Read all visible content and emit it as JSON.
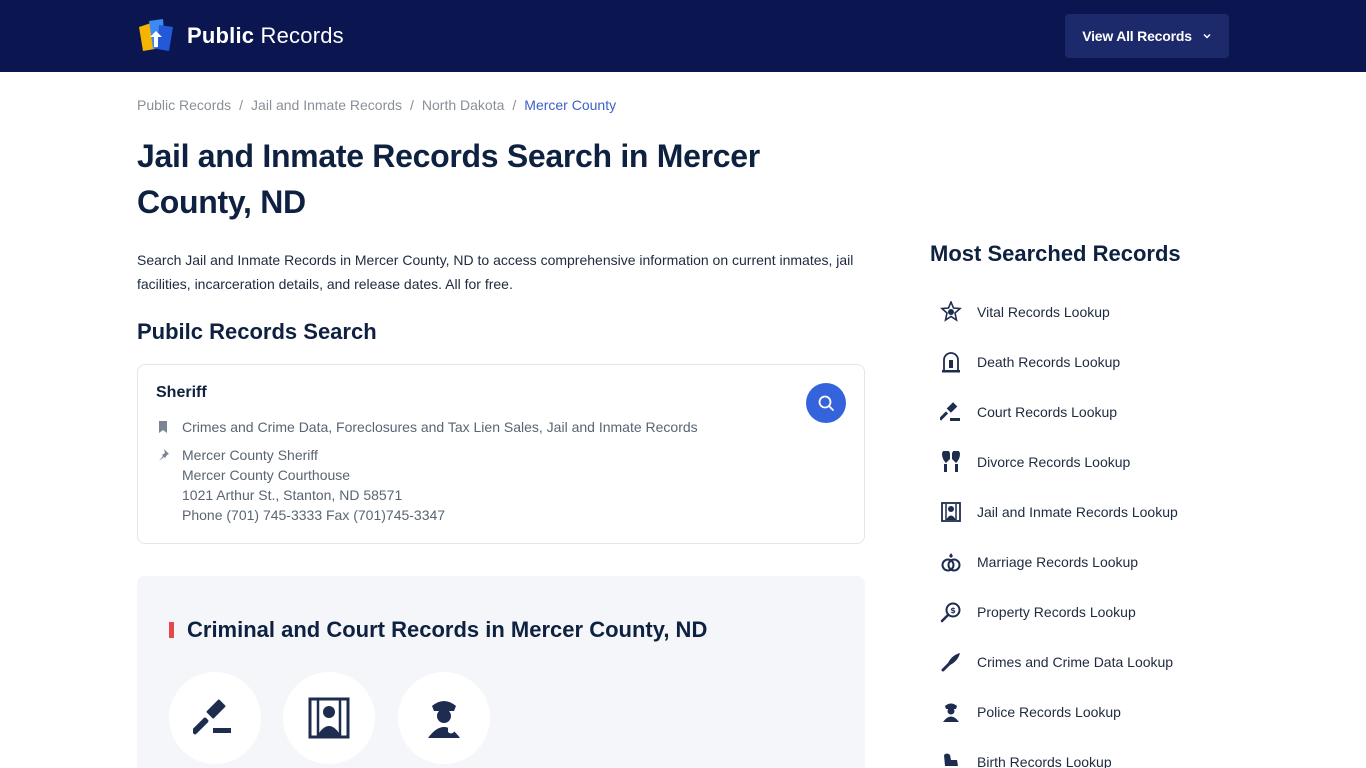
{
  "header": {
    "logo_bold": "Public",
    "logo_light": "Records",
    "view_all_label": "View All Records"
  },
  "breadcrumb": {
    "items": [
      "Public Records",
      "Jail and Inmate Records",
      "North Dakota"
    ],
    "current": "Mercer County"
  },
  "page": {
    "title": "Jail and Inmate Records Search in Mercer County, ND",
    "intro": "Search Jail and Inmate Records in Mercer County, ND to access comprehensive information on current inmates, jail facilities, incarceration details, and release dates. All for free."
  },
  "search_section": {
    "heading": "Pubilc Records Search",
    "card": {
      "title": "Sheriff",
      "categories": "Crimes and Crime Data, Foreclosures and Tax Lien Sales, Jail and Inmate Records",
      "address_lines": [
        "Mercer County Sheriff",
        "Mercer County Courthouse",
        "1021 Arthur St., Stanton, ND 58571",
        "Phone (701) 745-3333 Fax (701)745-3347"
      ]
    }
  },
  "criminal_section": {
    "heading": "Criminal and Court Records in Mercer County, ND",
    "icons": [
      "gavel-icon",
      "jail-icon",
      "police-officer-icon"
    ]
  },
  "sidebar": {
    "heading": "Most Searched Records",
    "items": [
      {
        "label": "Vital Records Lookup",
        "icon": "vital-icon"
      },
      {
        "label": "Death Records Lookup",
        "icon": "tombstone-icon"
      },
      {
        "label": "Court Records Lookup",
        "icon": "gavel-icon"
      },
      {
        "label": "Divorce Records Lookup",
        "icon": "divorce-icon"
      },
      {
        "label": "Jail and Inmate Records Lookup",
        "icon": "jail-icon"
      },
      {
        "label": "Marriage Records Lookup",
        "icon": "rings-icon"
      },
      {
        "label": "Property Records Lookup",
        "icon": "property-icon"
      },
      {
        "label": "Crimes and Crime Data Lookup",
        "icon": "knife-icon"
      },
      {
        "label": "Police Records Lookup",
        "icon": "police-icon"
      },
      {
        "label": "Birth Records Lookup",
        "icon": "rocking-horse-icon"
      }
    ]
  },
  "colors": {
    "header_bg": "#0b1650",
    "accent_blue": "#3563db",
    "accent_red": "#e24b4b",
    "text_dark": "#0f2140"
  }
}
